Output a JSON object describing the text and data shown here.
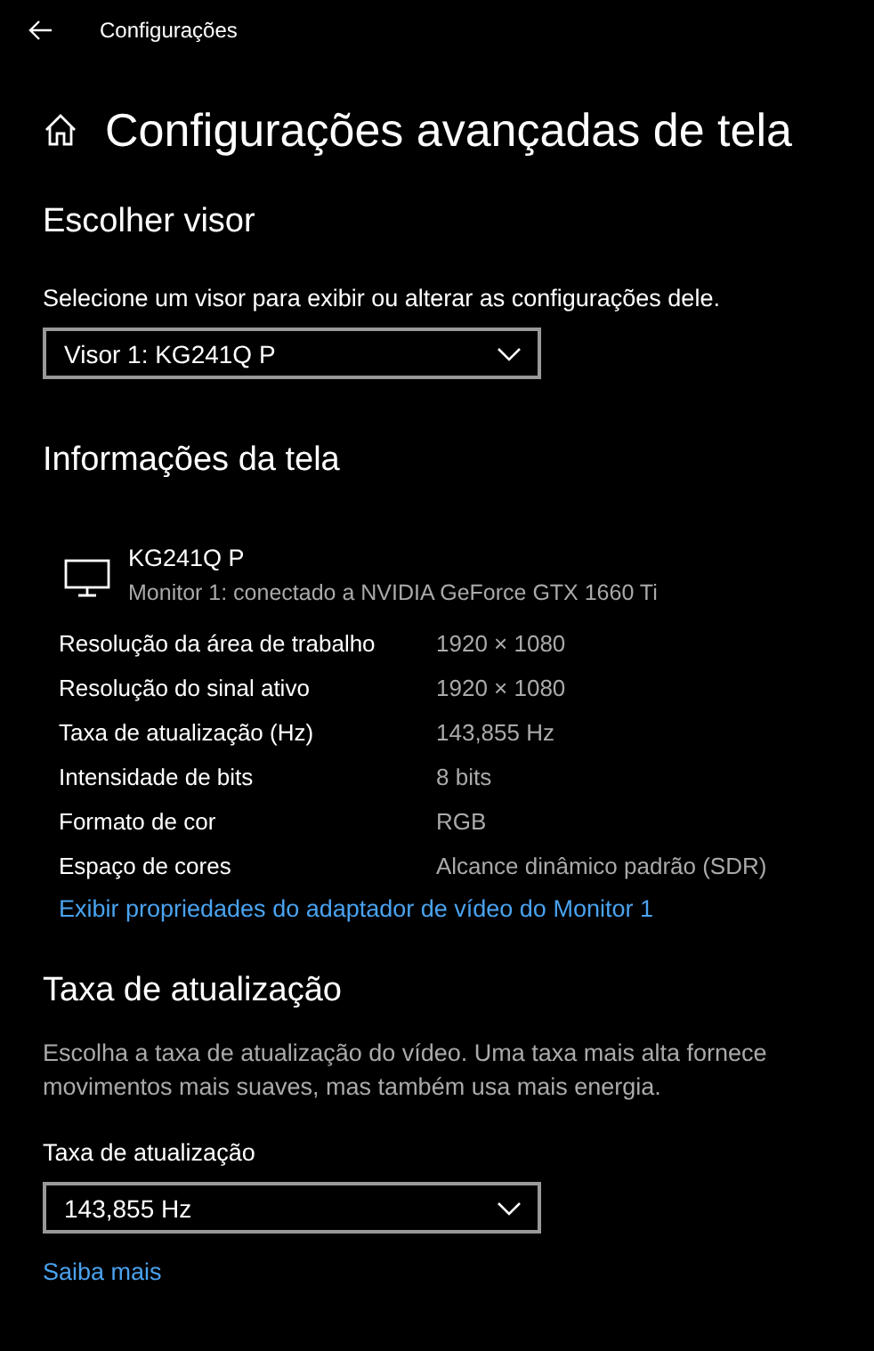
{
  "title_bar": {
    "title": "Configurações"
  },
  "page_title": "Configurações avançadas de tela",
  "choose_display": {
    "heading": "Escolher visor",
    "description": "Selecione um visor para exibir ou alterar as configurações dele.",
    "dropdown": {
      "value": "Visor 1: KG241Q P"
    }
  },
  "display_info": {
    "heading": "Informações da tela",
    "monitor": {
      "name": "KG241Q P",
      "connection": "Monitor 1: conectado a NVIDIA GeForce GTX 1660 Ti"
    },
    "rows": [
      {
        "label": "Resolução da área de trabalho",
        "value": "1920 × 1080"
      },
      {
        "label": "Resolução do sinal ativo",
        "value": "1920 × 1080"
      },
      {
        "label": "Taxa de atualização (Hz)",
        "value": "143,855 Hz"
      },
      {
        "label": "Intensidade de bits",
        "value": "8 bits"
      },
      {
        "label": "Formato de cor",
        "value": "RGB"
      },
      {
        "label": "Espaço de cores",
        "value": "Alcance dinâmico padrão (SDR)"
      }
    ],
    "link": "Exibir propriedades do adaptador de vídeo do Monitor 1"
  },
  "refresh_rate": {
    "heading": "Taxa de atualização",
    "description": "Escolha a taxa de atualização do vídeo. Uma taxa mais alta fornece movimentos mais suaves, mas também usa mais energia.",
    "field_label": "Taxa de atualização",
    "dropdown": {
      "value": "143,855 Hz"
    },
    "link": "Saiba mais"
  }
}
